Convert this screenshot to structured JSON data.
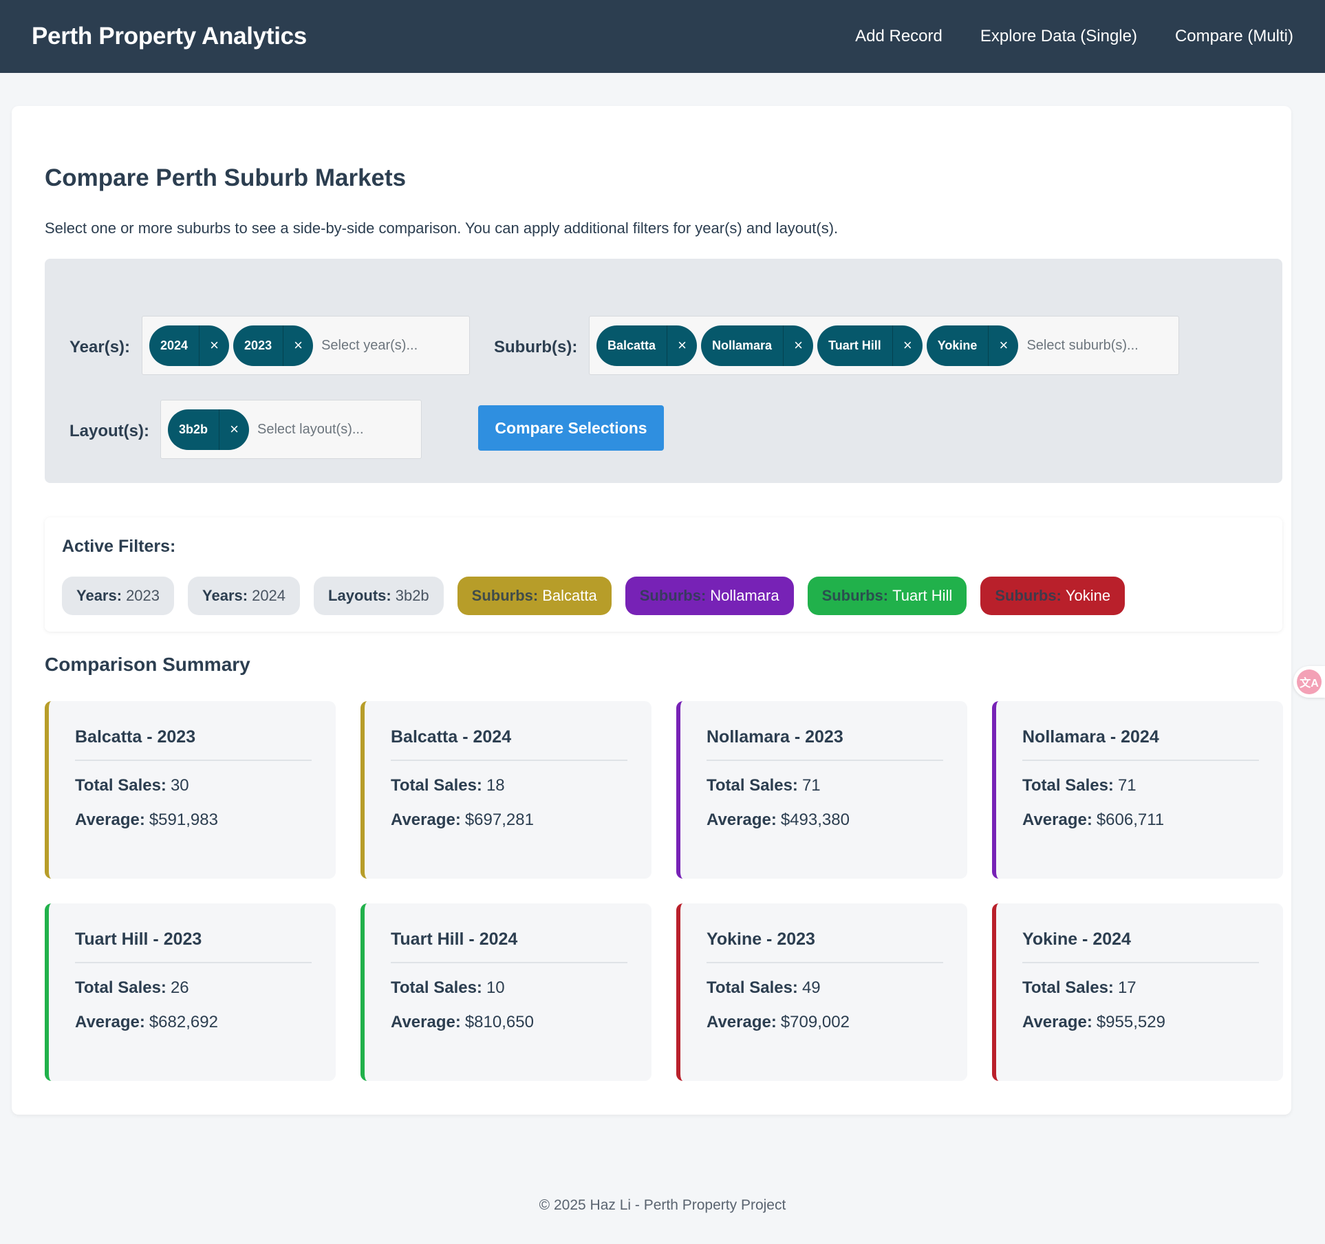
{
  "header": {
    "brand": "Perth Property Analytics",
    "nav": [
      "Add Record",
      "Explore Data (Single)",
      "Compare (Multi)"
    ]
  },
  "page": {
    "title": "Compare Perth Suburb Markets",
    "description": "Select one or more suburbs to see a side-by-side comparison. You can apply additional filters for year(s) and layout(s)."
  },
  "filters": {
    "years_label": "Year(s):",
    "years_selected": [
      "2024",
      "2023"
    ],
    "years_placeholder": "Select year(s)...",
    "suburbs_label": "Suburb(s):",
    "suburbs_selected": [
      "Balcatta",
      "Nollamara",
      "Tuart Hill",
      "Yokine"
    ],
    "suburbs_placeholder": "Select suburb(s)...",
    "layouts_label": "Layout(s):",
    "layouts_selected": [
      "3b2b"
    ],
    "layouts_placeholder": "Select layout(s)...",
    "remove_icon": "×",
    "compare_button": "Compare Selections"
  },
  "active_filters": {
    "title": "Active Filters:",
    "pills": [
      {
        "key": "Years:",
        "value": "2023",
        "bg": "#e5e8ec"
      },
      {
        "key": "Years:",
        "value": "2024",
        "bg": "#e5e8ec"
      },
      {
        "key": "Layouts:",
        "value": "3b2b",
        "bg": "#e5e8ec"
      },
      {
        "key": "Suburbs:",
        "value": "Balcatta",
        "bg": "#b79d29"
      },
      {
        "key": "Suburbs:",
        "value": "Nollamara",
        "bg": "#7722b6"
      },
      {
        "key": "Suburbs:",
        "value": "Tuart Hill",
        "bg": "#21b14b"
      },
      {
        "key": "Suburbs:",
        "value": "Yokine",
        "bg": "#b9202b"
      }
    ]
  },
  "summary": {
    "title": "Comparison Summary",
    "sales_label": "Total Sales:",
    "avg_label": "Average:",
    "cards": [
      {
        "title": "Balcatta - 2023",
        "sales": "30",
        "avg": "$591,983",
        "color": "#b79d29"
      },
      {
        "title": "Balcatta - 2024",
        "sales": "18",
        "avg": "$697,281",
        "color": "#b79d29"
      },
      {
        "title": "Nollamara - 2023",
        "sales": "71",
        "avg": "$493,380",
        "color": "#7722b6"
      },
      {
        "title": "Nollamara - 2024",
        "sales": "71",
        "avg": "$606,711",
        "color": "#7722b6"
      },
      {
        "title": "Tuart Hill - 2023",
        "sales": "26",
        "avg": "$682,692",
        "color": "#21b14b"
      },
      {
        "title": "Tuart Hill - 2024",
        "sales": "10",
        "avg": "$810,650",
        "color": "#21b14b"
      },
      {
        "title": "Yokine - 2023",
        "sales": "49",
        "avg": "$709,002",
        "color": "#b9202b"
      },
      {
        "title": "Yokine - 2024",
        "sales": "17",
        "avg": "$955,529",
        "color": "#b9202b"
      }
    ]
  },
  "footer": "© 2025 Haz Li - Perth Property Project",
  "translate_icon": "translate-icon"
}
